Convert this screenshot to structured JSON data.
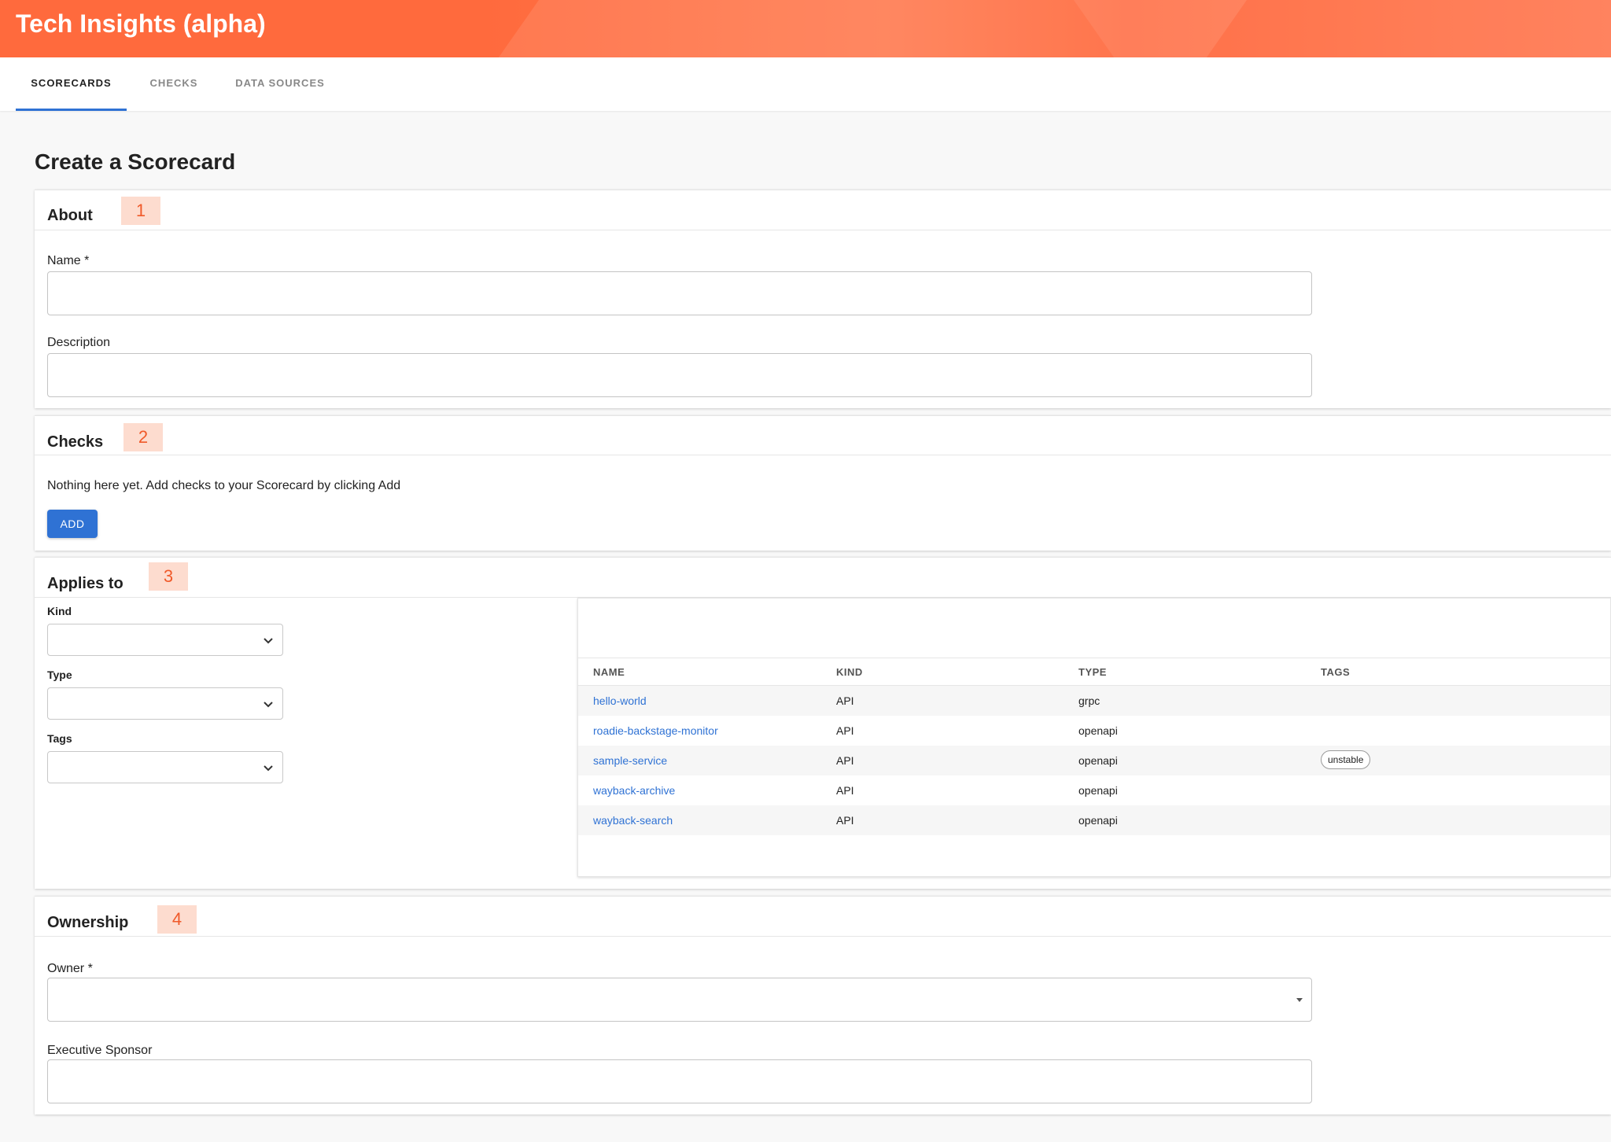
{
  "header": {
    "title": "Tech Insights (alpha)"
  },
  "tabs": [
    {
      "label": "SCORECARDS",
      "active": true
    },
    {
      "label": "CHECKS",
      "active": false
    },
    {
      "label": "DATA SOURCES",
      "active": false
    }
  ],
  "page_title": "Create a Scorecard",
  "sections": {
    "about": {
      "title": "About",
      "marker": "1",
      "name_label": "Name *",
      "name_value": "",
      "description_label": "Description",
      "description_value": ""
    },
    "checks": {
      "title": "Checks",
      "marker": "2",
      "empty_text": "Nothing here yet. Add checks to your Scorecard by clicking Add",
      "add_label": "ADD"
    },
    "applies_to": {
      "title": "Applies to",
      "marker": "3",
      "kind_label": "Kind",
      "type_label": "Type",
      "tags_label": "Tags",
      "columns": [
        "NAME",
        "KIND",
        "TYPE",
        "TAGS"
      ],
      "rows": [
        {
          "name": "hello-world",
          "kind": "API",
          "type": "grpc",
          "tag": ""
        },
        {
          "name": "roadie-backstage-monitor",
          "kind": "API",
          "type": "openapi",
          "tag": ""
        },
        {
          "name": "sample-service",
          "kind": "API",
          "type": "openapi",
          "tag": "unstable"
        },
        {
          "name": "wayback-archive",
          "kind": "API",
          "type": "openapi",
          "tag": ""
        },
        {
          "name": "wayback-search",
          "kind": "API",
          "type": "openapi",
          "tag": ""
        }
      ]
    },
    "ownership": {
      "title": "Ownership",
      "marker": "4",
      "owner_label": "Owner *",
      "owner_value": "",
      "sponsor_label": "Executive Sponsor",
      "sponsor_value": ""
    }
  },
  "colors": {
    "header": "#ff6a3d",
    "accent": "#2f72d4",
    "marker_bg": "#fddccf",
    "marker_text": "#f05a2a"
  }
}
